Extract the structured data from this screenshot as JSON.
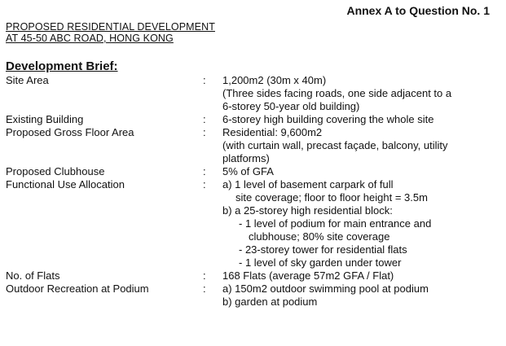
{
  "annex": "Annex A to Question No. 1",
  "project": {
    "line1": "PROPOSED RESIDENTIAL DEVELOPMENT",
    "line2": "AT 45-50 ABC ROAD, HONG KONG"
  },
  "brief_heading": "Development Brief:",
  "colon": ":",
  "site_area": {
    "label": "Site Area",
    "lines": [
      "1,200m2 (30m x 40m)",
      "(Three sides facing roads, one side adjacent to a",
      "6-storey 50-year old building)"
    ]
  },
  "existing_building": {
    "label": "Existing Building",
    "lines": [
      "6-storey high building covering the whole site"
    ]
  },
  "gfa": {
    "label": "Proposed Gross Floor Area",
    "lines": [
      "Residential: 9,600m2",
      "(with curtain wall, precast façade, balcony, utility",
      "platforms)"
    ]
  },
  "clubhouse": {
    "label": "Proposed Clubhouse",
    "lines": [
      "5% of GFA"
    ]
  },
  "functional_use": {
    "label": "Functional Use Allocation",
    "lines": [
      "a) 1 level of basement carpark of full",
      "site coverage; floor to floor height = 3.5m",
      "b) a 25-storey high residential block:",
      "- 1 level of podium for main entrance and",
      "clubhouse; 80% site coverage",
      "- 23-storey tower for residential flats",
      "- 1 level of sky garden under tower"
    ]
  },
  "flats": {
    "label": "No. of Flats",
    "lines": [
      "168 Flats (average 57m2 GFA / Flat)"
    ]
  },
  "outdoor": {
    "label": "Outdoor Recreation at Podium",
    "lines": [
      "a) 150m2 outdoor swimming pool at podium",
      "b) garden at podium"
    ]
  }
}
